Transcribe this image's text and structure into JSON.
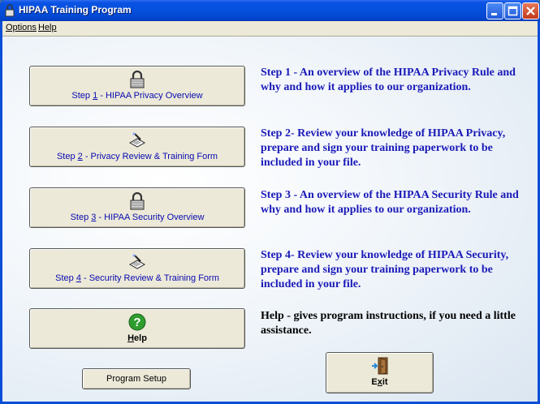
{
  "window": {
    "title": "HIPAA Training Program"
  },
  "menu": {
    "options": "Options",
    "help": "Help"
  },
  "steps": [
    {
      "num": "1",
      "pre": "Step ",
      "post": " - HIPAA Privacy Overview",
      "icon": "padlock-icon",
      "description": "Step 1 - An overview of the HIPAA Privacy Rule and why and how it applies to our organization."
    },
    {
      "num": "2",
      "pre": "Step ",
      "post": " - Privacy Review & Training Form",
      "icon": "signing-form-icon",
      "description": "Step 2- Review your knowledge of HIPAA Privacy, prepare and sign your training paperwork to be included in your file."
    },
    {
      "num": "3",
      "pre": "Step ",
      "post": " - HIPAA Security Overview",
      "icon": "padlock-icon",
      "description": "Step 3 - An overview of the HIPAA Security Rule and why and how it applies to our organization."
    },
    {
      "num": "4",
      "pre": "Step ",
      "post": " - Security Review & Training Form",
      "icon": "signing-form-icon",
      "description": "Step 4- Review your knowledge of HIPAA Security, prepare and sign your training paperwork to be included in your  file."
    }
  ],
  "help": {
    "label_first": "H",
    "label_rest": "elp",
    "icon": "question-mark-icon",
    "description": "Help - gives program instructions, if you need a little assistance."
  },
  "setup": {
    "label": "Program Setup"
  },
  "exit": {
    "label_first": "E",
    "label_mid": "x",
    "label_rest": "it",
    "icon": "exit-door-icon"
  },
  "colors": {
    "title_bar": "#0550dc",
    "button_face": "#ece9d8",
    "step_text": "#1a1ab8",
    "help_text": "#000000"
  }
}
